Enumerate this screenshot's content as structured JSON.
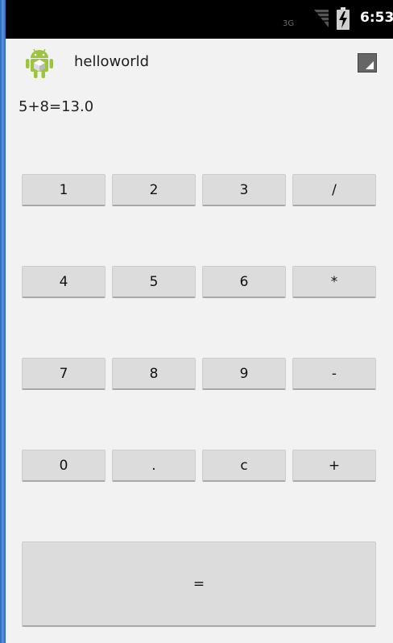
{
  "status_bar": {
    "network_label": "3G",
    "time": "6:53",
    "icons": [
      "signal-icon",
      "battery-charging-icon"
    ]
  },
  "title_bar": {
    "app_title": "helloworld",
    "app_icon": "android-robot-icon",
    "overflow_icon": "overflow-menu-icon"
  },
  "display": {
    "result": "5+8=13.0"
  },
  "keypad": {
    "rows": [
      [
        "1",
        "2",
        "3",
        "/"
      ],
      [
        "4",
        "5",
        "6",
        "*"
      ],
      [
        "7",
        "8",
        "9",
        "-"
      ],
      [
        "0",
        ".",
        "c",
        "+"
      ]
    ],
    "equals": "="
  },
  "colors": {
    "background": "#f2f2f2",
    "button": "#dcdcdc",
    "status_bar": "#000000"
  }
}
